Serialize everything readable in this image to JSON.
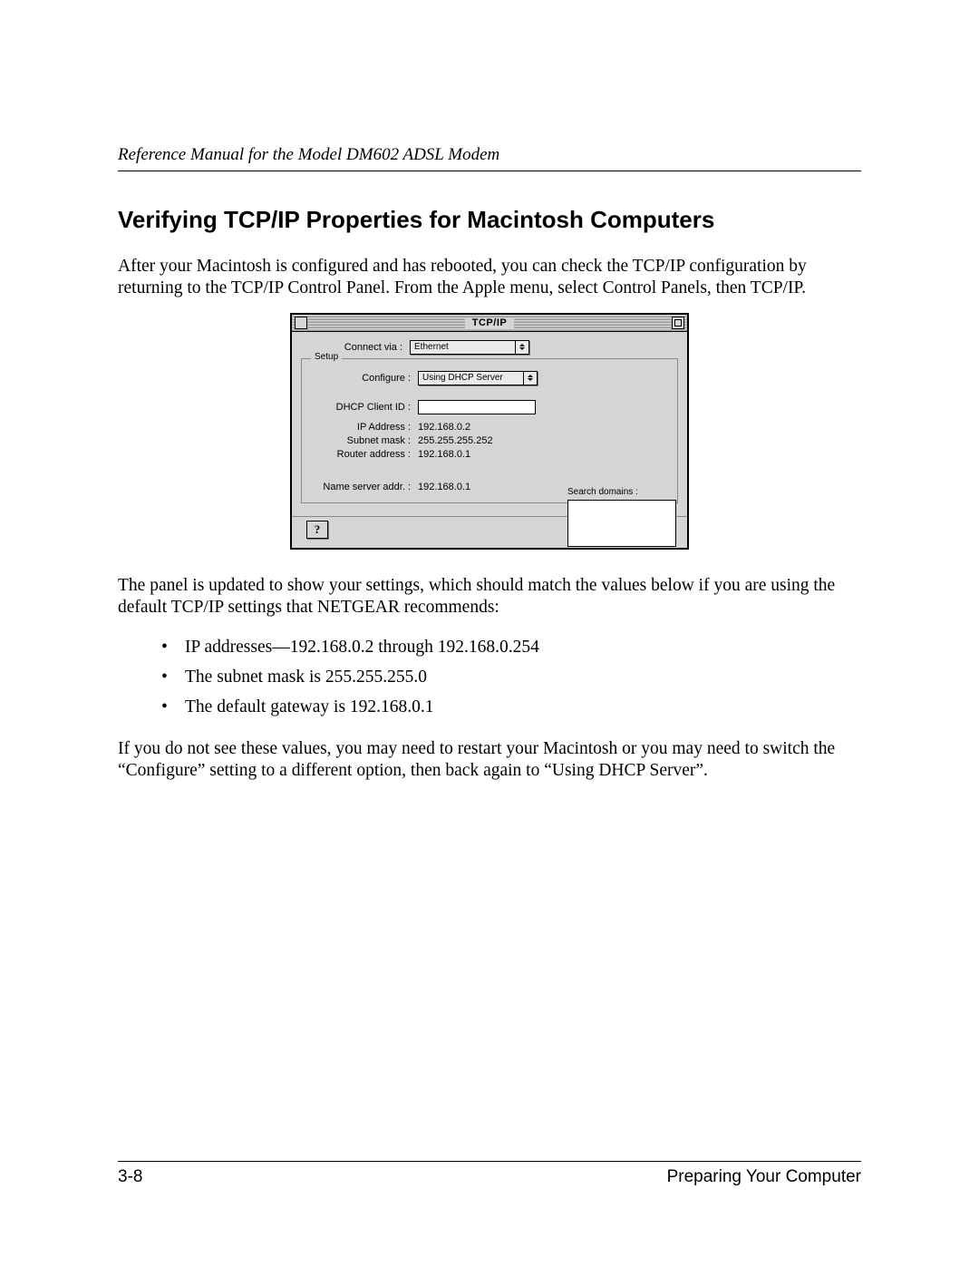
{
  "header": {
    "running_title": "Reference Manual for the Model DM602 ADSL Modem"
  },
  "section": {
    "title": "Verifying TCP/IP Properties for Macintosh Computers",
    "intro": "After your Macintosh is configured and has rebooted, you can check the TCP/IP configuration by returning to the TCP/IP Control Panel. From the Apple menu, select Control Panels, then TCP/IP.",
    "after_figure": "The panel is updated to show your settings, which should match the values below if you are using the default TCP/IP settings that NETGEAR recommends:",
    "bullets": [
      "IP addresses—192.168.0.2 through 192.168.0.254",
      "The subnet mask is 255.255.255.0",
      "The default gateway is 192.168.0.1"
    ],
    "closing": "If you do not see these values, you may need to restart your Macintosh or you may need to switch the “Configure” setting to a different option, then back again to “Using DHCP Server”."
  },
  "mac_panel": {
    "title": "TCP/IP",
    "connect_via_label": "Connect via :",
    "connect_via_value": "Ethernet",
    "setup_legend": "Setup",
    "configure_label": "Configure :",
    "configure_value": "Using DHCP Server",
    "dhcp_client_id_label": "DHCP Client ID :",
    "dhcp_client_id_value": "",
    "ip_address_label": "IP Address :",
    "ip_address_value": "192.168.0.2",
    "subnet_mask_label": "Subnet mask :",
    "subnet_mask_value": "255.255.255.252",
    "router_address_label": "Router address :",
    "router_address_value": "192.168.0.1",
    "name_server_label": "Name server addr. :",
    "name_server_value": "192.168.0.1",
    "search_domains_label": "Search domains :",
    "help_glyph": "?"
  },
  "footer": {
    "page_number": "3-8",
    "chapter": "Preparing Your Computer"
  }
}
